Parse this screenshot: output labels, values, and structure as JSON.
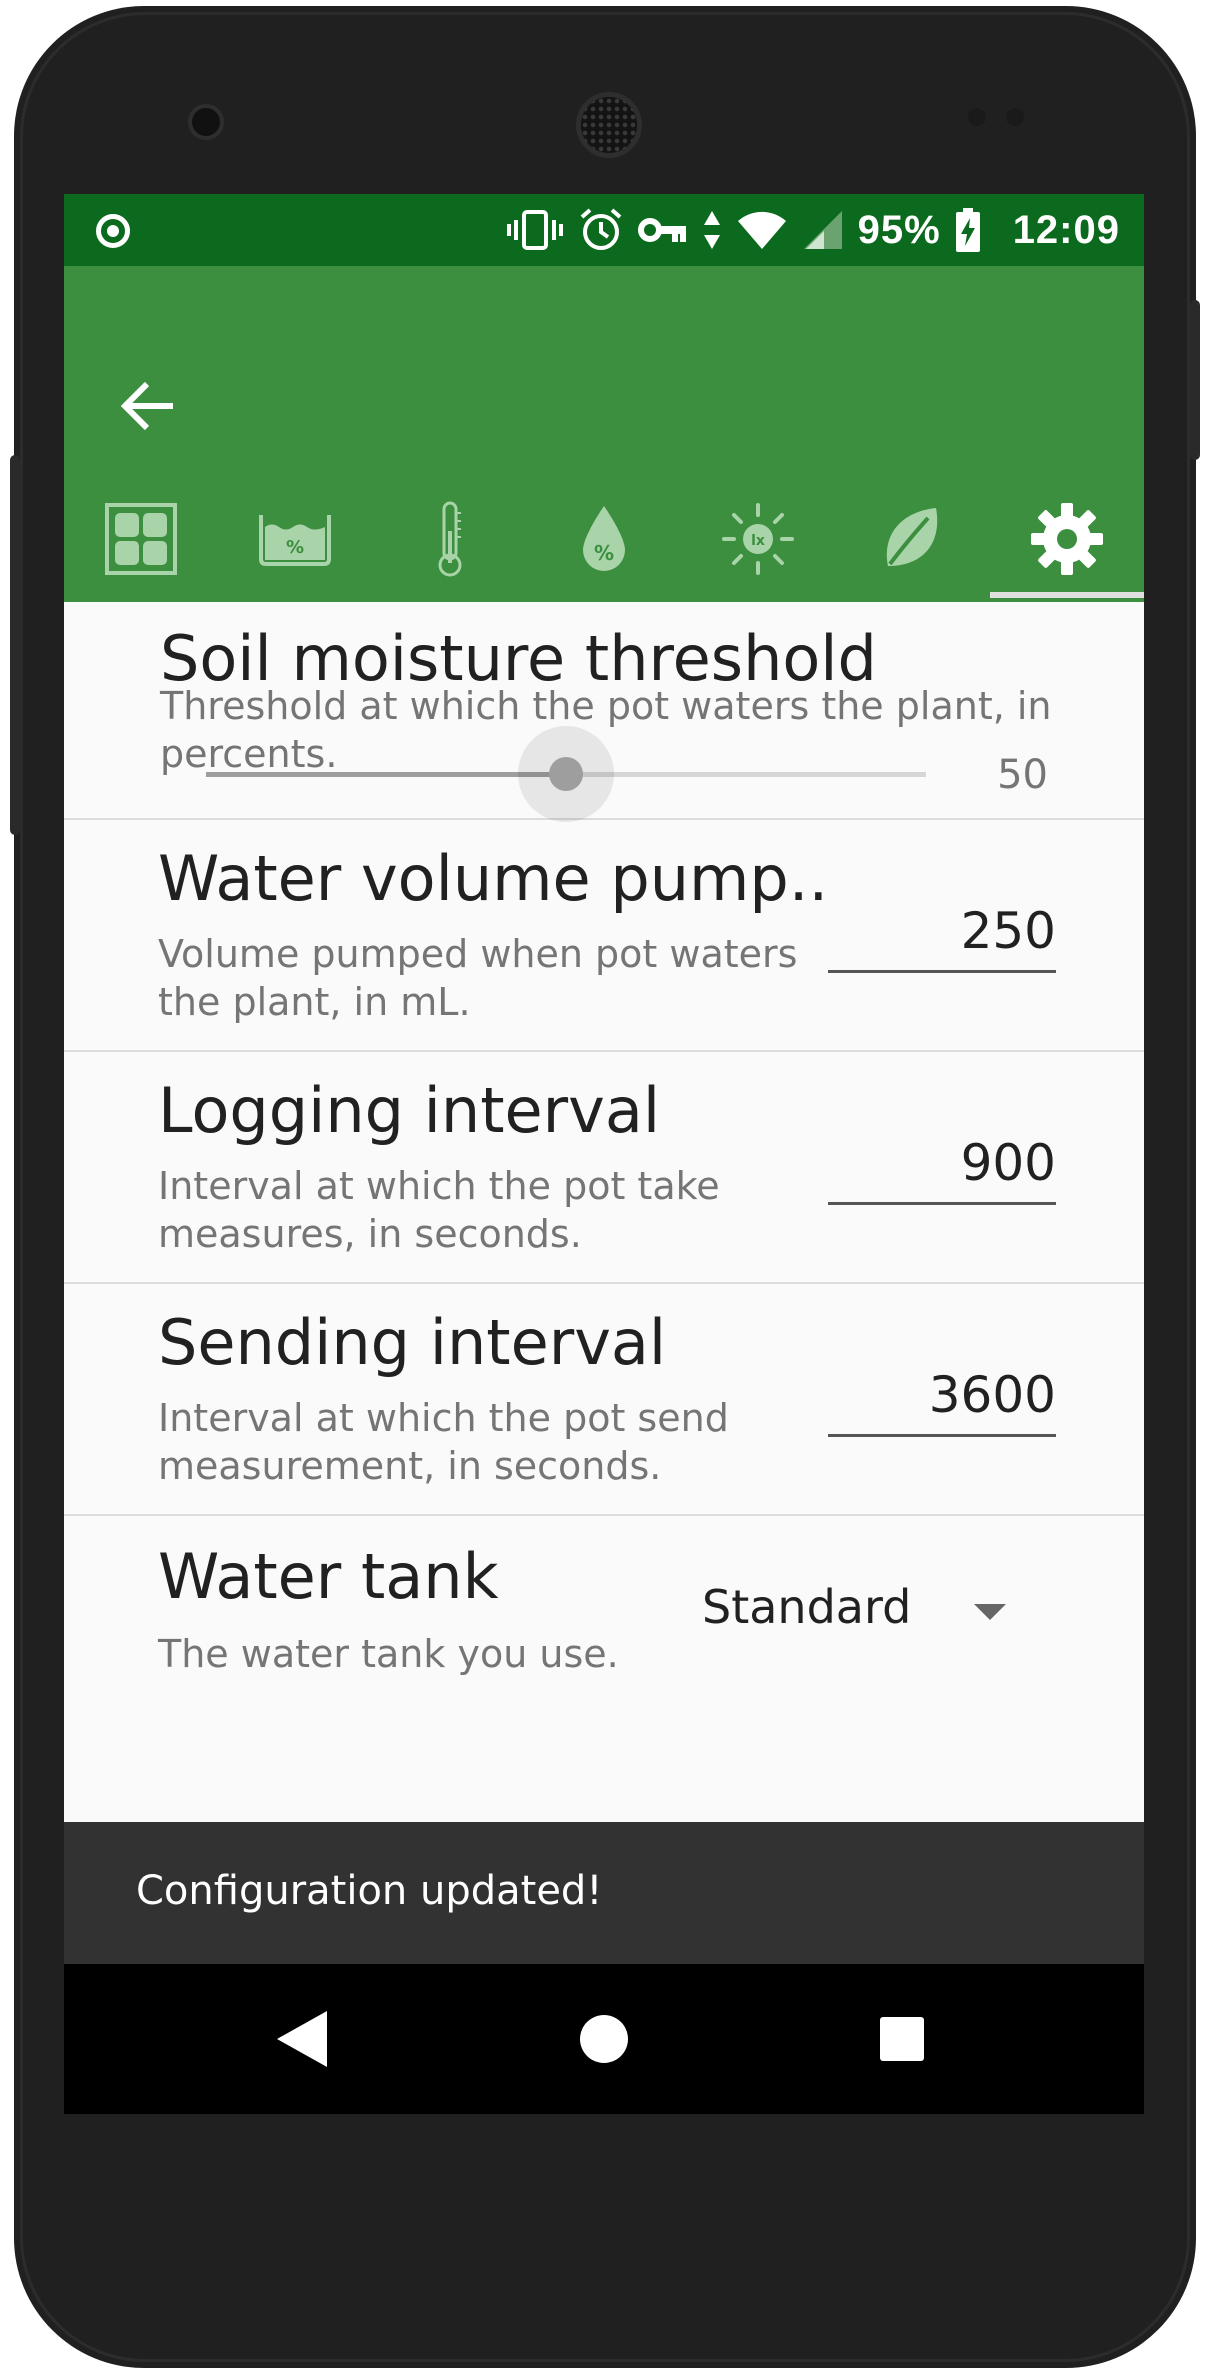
{
  "status_bar": {
    "battery": "95%",
    "time": "12:09"
  },
  "tabs": [
    {
      "name": "dashboard-icon"
    },
    {
      "name": "water-tank-level-icon"
    },
    {
      "name": "thermometer-icon"
    },
    {
      "name": "humidity-drop-icon"
    },
    {
      "name": "light-lux-icon"
    },
    {
      "name": "leaf-icon"
    },
    {
      "name": "gear-icon",
      "active": true
    }
  ],
  "prefs": {
    "soil": {
      "title": "Soil moisture threshold",
      "summary": "Threshold at which the pot waters the plant, in percents.",
      "value": "50",
      "level_percent": 50
    },
    "water_volume": {
      "title": "Water volume pump..",
      "summary": "Volume pumped when pot waters the plant, in mL.",
      "value": "250"
    },
    "logging": {
      "title": "Logging interval",
      "summary": "Interval at which the pot take measures, in seconds.",
      "value": "900"
    },
    "sending": {
      "title": "Sending interval",
      "summary": "Interval at which the pot send measurement, in seconds.",
      "value": "3600"
    },
    "tank": {
      "title": "Water tank",
      "summary": "The water tank you use.",
      "selected": "Standard"
    }
  },
  "snackbar": {
    "message": "Configuration updated!"
  },
  "colors": {
    "status_bar": "#0b6a1d",
    "app_bar": "#3b8f3f",
    "tab_icon_inactive": "#a9d3a8",
    "snackbar": "#323232"
  }
}
